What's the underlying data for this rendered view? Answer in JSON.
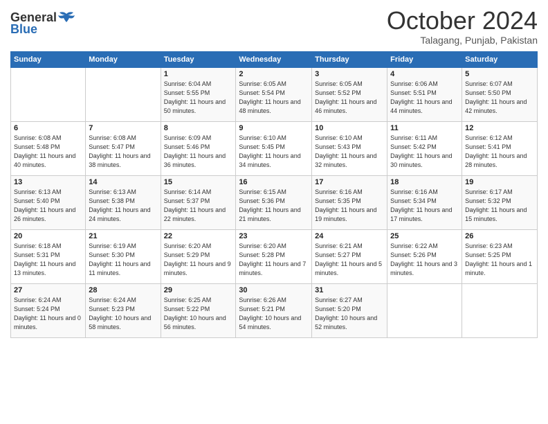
{
  "header": {
    "logo_general": "General",
    "logo_blue": "Blue",
    "month_title": "October 2024",
    "location": "Talagang, Punjab, Pakistan"
  },
  "days_of_week": [
    "Sunday",
    "Monday",
    "Tuesday",
    "Wednesday",
    "Thursday",
    "Friday",
    "Saturday"
  ],
  "weeks": [
    [
      {
        "num": "",
        "info": ""
      },
      {
        "num": "",
        "info": ""
      },
      {
        "num": "1",
        "info": "Sunrise: 6:04 AM\nSunset: 5:55 PM\nDaylight: 11 hours and 50 minutes."
      },
      {
        "num": "2",
        "info": "Sunrise: 6:05 AM\nSunset: 5:54 PM\nDaylight: 11 hours and 48 minutes."
      },
      {
        "num": "3",
        "info": "Sunrise: 6:05 AM\nSunset: 5:52 PM\nDaylight: 11 hours and 46 minutes."
      },
      {
        "num": "4",
        "info": "Sunrise: 6:06 AM\nSunset: 5:51 PM\nDaylight: 11 hours and 44 minutes."
      },
      {
        "num": "5",
        "info": "Sunrise: 6:07 AM\nSunset: 5:50 PM\nDaylight: 11 hours and 42 minutes."
      }
    ],
    [
      {
        "num": "6",
        "info": "Sunrise: 6:08 AM\nSunset: 5:48 PM\nDaylight: 11 hours and 40 minutes."
      },
      {
        "num": "7",
        "info": "Sunrise: 6:08 AM\nSunset: 5:47 PM\nDaylight: 11 hours and 38 minutes."
      },
      {
        "num": "8",
        "info": "Sunrise: 6:09 AM\nSunset: 5:46 PM\nDaylight: 11 hours and 36 minutes."
      },
      {
        "num": "9",
        "info": "Sunrise: 6:10 AM\nSunset: 5:45 PM\nDaylight: 11 hours and 34 minutes."
      },
      {
        "num": "10",
        "info": "Sunrise: 6:10 AM\nSunset: 5:43 PM\nDaylight: 11 hours and 32 minutes."
      },
      {
        "num": "11",
        "info": "Sunrise: 6:11 AM\nSunset: 5:42 PM\nDaylight: 11 hours and 30 minutes."
      },
      {
        "num": "12",
        "info": "Sunrise: 6:12 AM\nSunset: 5:41 PM\nDaylight: 11 hours and 28 minutes."
      }
    ],
    [
      {
        "num": "13",
        "info": "Sunrise: 6:13 AM\nSunset: 5:40 PM\nDaylight: 11 hours and 26 minutes."
      },
      {
        "num": "14",
        "info": "Sunrise: 6:13 AM\nSunset: 5:38 PM\nDaylight: 11 hours and 24 minutes."
      },
      {
        "num": "15",
        "info": "Sunrise: 6:14 AM\nSunset: 5:37 PM\nDaylight: 11 hours and 22 minutes."
      },
      {
        "num": "16",
        "info": "Sunrise: 6:15 AM\nSunset: 5:36 PM\nDaylight: 11 hours and 21 minutes."
      },
      {
        "num": "17",
        "info": "Sunrise: 6:16 AM\nSunset: 5:35 PM\nDaylight: 11 hours and 19 minutes."
      },
      {
        "num": "18",
        "info": "Sunrise: 6:16 AM\nSunset: 5:34 PM\nDaylight: 11 hours and 17 minutes."
      },
      {
        "num": "19",
        "info": "Sunrise: 6:17 AM\nSunset: 5:32 PM\nDaylight: 11 hours and 15 minutes."
      }
    ],
    [
      {
        "num": "20",
        "info": "Sunrise: 6:18 AM\nSunset: 5:31 PM\nDaylight: 11 hours and 13 minutes."
      },
      {
        "num": "21",
        "info": "Sunrise: 6:19 AM\nSunset: 5:30 PM\nDaylight: 11 hours and 11 minutes."
      },
      {
        "num": "22",
        "info": "Sunrise: 6:20 AM\nSunset: 5:29 PM\nDaylight: 11 hours and 9 minutes."
      },
      {
        "num": "23",
        "info": "Sunrise: 6:20 AM\nSunset: 5:28 PM\nDaylight: 11 hours and 7 minutes."
      },
      {
        "num": "24",
        "info": "Sunrise: 6:21 AM\nSunset: 5:27 PM\nDaylight: 11 hours and 5 minutes."
      },
      {
        "num": "25",
        "info": "Sunrise: 6:22 AM\nSunset: 5:26 PM\nDaylight: 11 hours and 3 minutes."
      },
      {
        "num": "26",
        "info": "Sunrise: 6:23 AM\nSunset: 5:25 PM\nDaylight: 11 hours and 1 minute."
      }
    ],
    [
      {
        "num": "27",
        "info": "Sunrise: 6:24 AM\nSunset: 5:24 PM\nDaylight: 11 hours and 0 minutes."
      },
      {
        "num": "28",
        "info": "Sunrise: 6:24 AM\nSunset: 5:23 PM\nDaylight: 10 hours and 58 minutes."
      },
      {
        "num": "29",
        "info": "Sunrise: 6:25 AM\nSunset: 5:22 PM\nDaylight: 10 hours and 56 minutes."
      },
      {
        "num": "30",
        "info": "Sunrise: 6:26 AM\nSunset: 5:21 PM\nDaylight: 10 hours and 54 minutes."
      },
      {
        "num": "31",
        "info": "Sunrise: 6:27 AM\nSunset: 5:20 PM\nDaylight: 10 hours and 52 minutes."
      },
      {
        "num": "",
        "info": ""
      },
      {
        "num": "",
        "info": ""
      }
    ]
  ]
}
